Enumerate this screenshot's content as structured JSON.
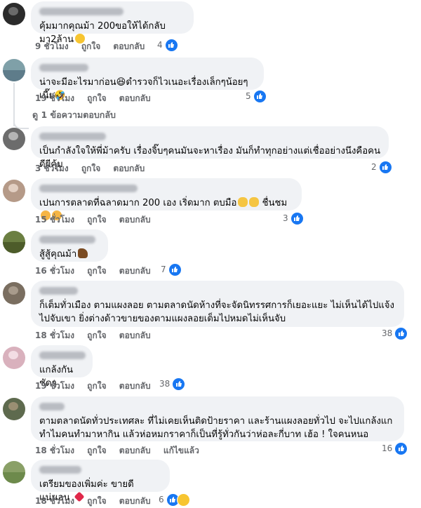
{
  "comments": [
    {
      "text": "คุ้มมากคุณม้า 200ขอให้ได้กลับมา2ล้าน",
      "time": "9 ชั่วโมง",
      "like": "ถูกใจ",
      "reply": "ตอบกลับ",
      "count": "4"
    },
    {
      "text": "น่าจะมีอะไรมาก่อน😆ดำรวจก็ไวเนอะเรื่องเล็กๆน้อยๆเนี๊ย🤣",
      "time": "19 ชั่วโมง",
      "like": "ถูกใจ",
      "reply": "ตอบกลับ",
      "count": "5",
      "view_replies": "ดู 1 ข้อความตอบกลับ"
    },
    {
      "text": "เป็นกำลังใจให้พี่ม้าครับ เรื่องจิ๊บๆคนมันจะหาเรื่อง มันก็ทำทุกอย่างแต่เชื่ออย่างนึงคือคนดีผีคุ้ม",
      "time": "3 ชั่วโมง",
      "like": "ถูกใจ",
      "reply": "ตอบกลับ",
      "count": "2"
    },
    {
      "text": "เปนการตลาดที่ฉลาดมาก 200 เอง เริ่ดมาก ตบมือ",
      "text2": "ชื่นชม",
      "time": "15 ชั่วโมง",
      "like": "ถูกใจ",
      "reply": "ตอบกลับ",
      "count": "3"
    },
    {
      "text": "สู้สู้คุณม้า",
      "time": "16 ชั่วโมง",
      "like": "ถูกใจ",
      "reply": "ตอบกลับ",
      "count": "7"
    },
    {
      "text": "ก็เต็มทั่วเมือง ตามแผงลอย ตามตลาดนัดห้างที่จะจัดนิทรรศการก็เยอะแยะ ไม่เห็นได้ไปแจ้งไปจับเขา ยิ่งต่างด้าวขายของตามแผงลอยเต็มไปหมดไม่เห็นจับ",
      "time": "18 ชั่วโมง",
      "like": "ถูกใจ",
      "reply": "ตอบกลับ",
      "count": "38"
    },
    {
      "text": "แกล้งกันชัดๆ",
      "time": "19 ชั่วโมง",
      "like": "ถูกใจ",
      "reply": "ตอบกลับ",
      "count": "38"
    },
    {
      "text": "ตามตลาดนัดทั่วประเทศละ ที่ไม่เคยเห็นติดป้ายราคา และร้านแผงลอยทั่วไป จะไปแกล้งแกทำไมคนทำมาหากิน แล้วห่อหมกราคาก็เป็นที่รู้ทั่วกันว่าห่อละกี่บาท เฮ้อ ! ใจคนหนอ",
      "time": "18 ชั่วโมง",
      "like": "ถูกใจ",
      "reply": "ตอบกลับ",
      "edited": "แก้ไขแล้ว",
      "count": "16"
    },
    {
      "text": "เตรียมของเพิ่มค่ะ ขายดีแน่นอน",
      "time": "18 ชั่วโมง",
      "like": "ถูกใจ",
      "reply": "ตอบกลับ",
      "count": "6"
    }
  ],
  "icons": {
    "like": "thumbs-up-icon",
    "haha": "laughing-face-icon"
  },
  "colors": {
    "accent": "#1877f2",
    "bubble": "#f0f2f5",
    "meta": "#65676b"
  }
}
